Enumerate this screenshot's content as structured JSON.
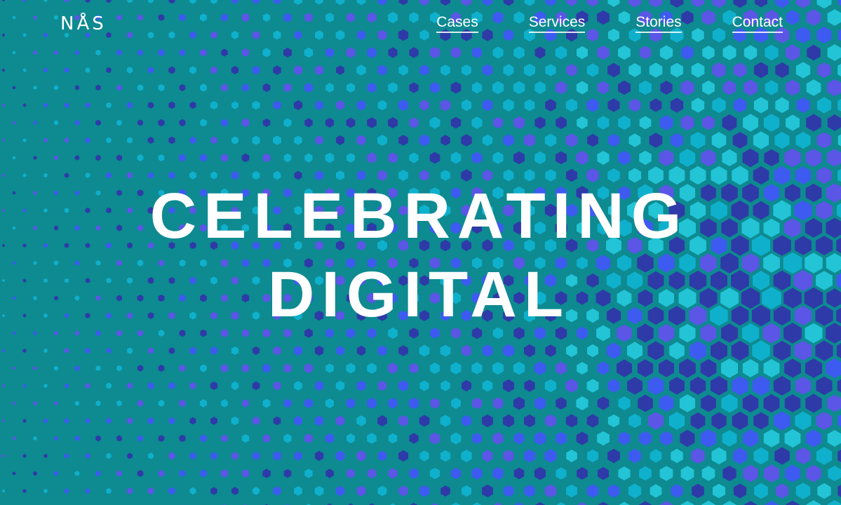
{
  "brand": {
    "logo": "NÅS"
  },
  "nav": {
    "items": [
      {
        "label": "Cases"
      },
      {
        "label": "Services"
      },
      {
        "label": "Stories"
      },
      {
        "label": "Contact"
      }
    ]
  },
  "hero": {
    "line1": "CELEBRATING",
    "line2": "DIGITAL"
  },
  "colors": {
    "background": "#0e8a91",
    "hex_palette": [
      "#0fb0cc",
      "#3d5bf0",
      "#5b56e6",
      "#2e3aa8",
      "#22c4d6",
      "#1aa3c2"
    ],
    "text": "#ffffff"
  }
}
